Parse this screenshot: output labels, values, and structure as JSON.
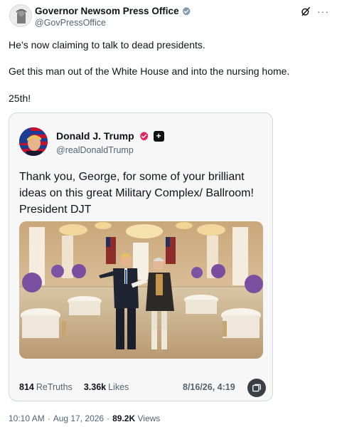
{
  "post": {
    "author": {
      "display_name": "Governor Newsom Press Office",
      "handle": "@GovPressOffice",
      "verified_badge_color": "#829aab"
    },
    "text_lines": [
      "He’s now claiming to talk to dead presidents.",
      "Get this man out of the White House and into the nursing home.",
      "25th!"
    ],
    "footer": {
      "time": "10:10 AM",
      "separator1": "·",
      "date": "Aug 17, 2026",
      "separator2": "·",
      "views_count": "89.2K",
      "views_label": "Views"
    },
    "icons": {
      "grok": "grok-icon",
      "more": "more-options-icon"
    },
    "more_glyph": "···"
  },
  "quote": {
    "author": {
      "display_name": "Donald J. Trump",
      "handle": "@realDonaldTrump",
      "badge_color": "#e0245e",
      "plus_glyph": "+"
    },
    "text": "Thank you, George, for some of your brilliant ideas on this great Military Complex/ Ballroom! President DJT",
    "stats": {
      "retruths_count": "814",
      "retruths_label": "ReTruths",
      "likes_count": "3.36k",
      "likes_label": "Likes",
      "date": "8/16/26, 4:19"
    }
  }
}
